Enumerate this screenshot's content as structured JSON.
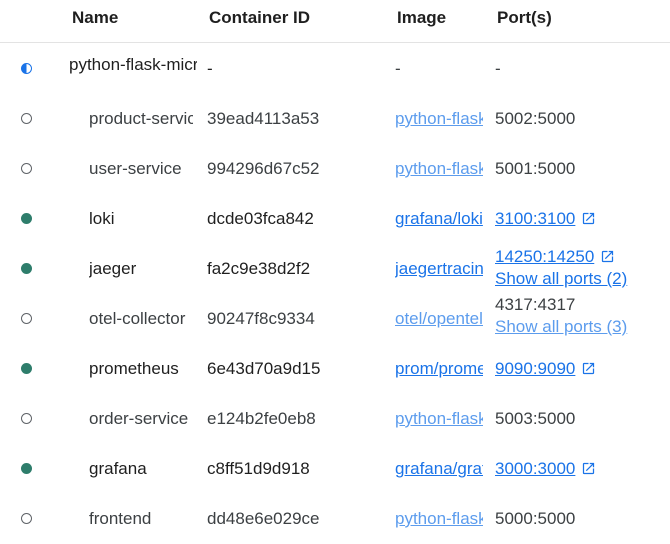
{
  "table": {
    "headers": {
      "name": "Name",
      "container_id": "Container ID",
      "image": "Image",
      "ports": "Port(s)"
    },
    "rows": [
      {
        "status": "partial",
        "name": "python-flask-microservices",
        "container_id": "-",
        "image": "-",
        "ports": [
          "-"
        ]
      },
      {
        "status": "stopped",
        "name": "product-service",
        "container_id": "39ead4113a53",
        "image": "python-flask-microservices-product-service",
        "ports": [
          "5002:5000"
        ]
      },
      {
        "status": "stopped",
        "name": "user-service",
        "container_id": "994296d67c52",
        "image": "python-flask-microservices-user-service",
        "ports": [
          "5001:5000"
        ]
      },
      {
        "status": "running",
        "name": "loki",
        "container_id": "dcde03fca842",
        "image": "grafana/loki",
        "ports": [
          "3100:3100"
        ]
      },
      {
        "status": "running",
        "name": "jaeger",
        "container_id": "fa2c9e38d2f2",
        "image": "jaegertracing/all-in-one",
        "ports": [
          "14250:14250",
          "Show all ports (2)"
        ]
      },
      {
        "status": "stopped",
        "name": "otel-collector",
        "container_id": "90247f8c9334",
        "image": "otel/opentelemetry-collector",
        "ports": [
          "4317:4317",
          "Show all ports (3)"
        ]
      },
      {
        "status": "running",
        "name": "prometheus",
        "container_id": "6e43d70a9d15",
        "image": "prom/prometheus",
        "ports": [
          "9090:9090"
        ]
      },
      {
        "status": "stopped",
        "name": "order-service",
        "container_id": "e124b2fe0eb8",
        "image": "python-flask-microservices-order-service",
        "ports": [
          "5003:5000"
        ]
      },
      {
        "status": "running",
        "name": "grafana",
        "container_id": "c8ff51d9d918",
        "image": "grafana/grafana",
        "ports": [
          "3000:3000"
        ]
      },
      {
        "status": "stopped",
        "name": "frontend",
        "container_id": "dd48e6e029ce",
        "image": "python-flask-microservices-frontend",
        "ports": [
          "5000:5000"
        ]
      }
    ]
  },
  "colors": {
    "running": "#2e7d6b",
    "partial": "#1a73e8",
    "link": "#1a73e8"
  },
  "icons": {
    "external_link": "external-link-icon"
  }
}
